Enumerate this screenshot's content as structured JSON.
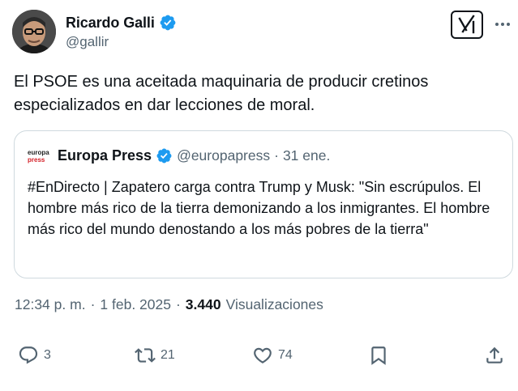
{
  "author": {
    "name": "Ricardo Galli",
    "handle": "@gallir",
    "verified": true
  },
  "tweet": {
    "text": "El PSOE es una aceitada maquinaria de producir cretinos especializados en dar lecciones de moral."
  },
  "quote": {
    "logo_line1": "europa",
    "logo_line2": "press",
    "author_name": "Europa Press",
    "author_handle": "@europapress",
    "separator": "·",
    "date": "31 ene.",
    "text": "#EnDirecto | Zapatero carga contra Trump y Musk: \"Sin escrúpulos. El hombre más rico de la tierra demonizando a los inmigrantes. El hombre más rico del mundo denostando a los más pobres de la tierra\""
  },
  "meta": {
    "time": "12:34 p. m.",
    "sep1": "·",
    "date": "1 feb. 2025",
    "sep2": "·",
    "views_count": "3.440",
    "views_label": "Visualizaciones"
  },
  "actions": {
    "replies": "3",
    "reposts": "21",
    "likes": "74"
  },
  "colors": {
    "verified": "#1d9bf0",
    "text": "#0f1419",
    "secondary": "#536471",
    "border": "#cfd9de",
    "press_red": "#d41f26"
  },
  "icons": [
    "verified-badge-icon",
    "grok-icon",
    "more-icon",
    "reply-icon",
    "repost-icon",
    "like-icon",
    "bookmark-icon",
    "share-icon"
  ]
}
